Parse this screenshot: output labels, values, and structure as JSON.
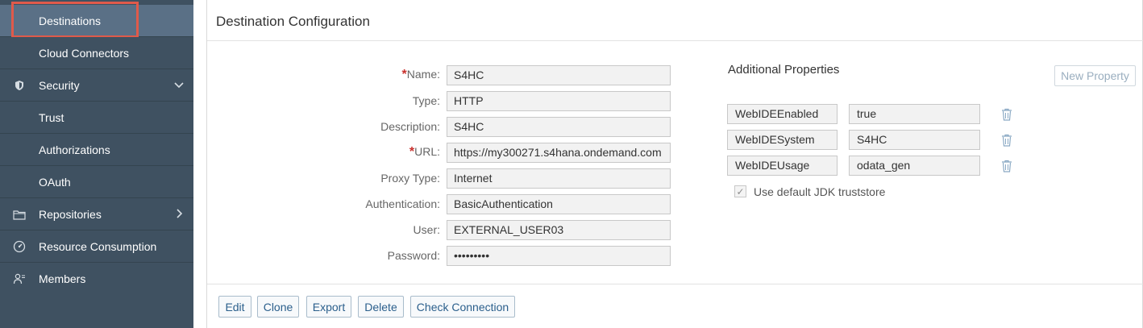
{
  "sidebar": {
    "items": [
      {
        "label": "Destinations",
        "icon": "",
        "active": true
      },
      {
        "label": "Cloud Connectors",
        "icon": ""
      },
      {
        "label": "Security",
        "icon": "shield-icon",
        "chevron": "chevron-down-icon"
      },
      {
        "label": "Trust",
        "icon": ""
      },
      {
        "label": "Authorizations",
        "icon": ""
      },
      {
        "label": "OAuth",
        "icon": ""
      },
      {
        "label": "Repositories",
        "icon": "folder-icon",
        "chevron": "chevron-right-icon"
      },
      {
        "label": "Resource Consumption",
        "icon": "gauge-icon"
      },
      {
        "label": "Members",
        "icon": "members-icon"
      }
    ]
  },
  "main": {
    "title": "Destination Configuration",
    "fields": [
      {
        "label": "Name:",
        "value": "S4HC",
        "required": true
      },
      {
        "label": "Type:",
        "value": "HTTP",
        "required": false
      },
      {
        "label": "Description:",
        "value": "S4HC",
        "required": false
      },
      {
        "label": "URL:",
        "value": "https://my300271.s4hana.ondemand.com",
        "required": true
      },
      {
        "label": "Proxy Type:",
        "value": "Internet",
        "required": false
      },
      {
        "label": "Authentication:",
        "value": "BasicAuthentication",
        "required": false
      },
      {
        "label": "User:",
        "value": "EXTERNAL_USER03",
        "required": false
      },
      {
        "label": "Password:",
        "value": "•••••••••",
        "required": false
      }
    ],
    "required_marker": "*",
    "additional": {
      "title": "Additional Properties",
      "new_property_label": "New Property",
      "properties": [
        {
          "key": "WebIDEEnabled",
          "value": "true"
        },
        {
          "key": "WebIDESystem",
          "value": "S4HC"
        },
        {
          "key": "WebIDEUsage",
          "value": "odata_gen"
        }
      ],
      "checkbox_label": "Use default JDK truststore",
      "checkbox_checked": true
    },
    "buttons": {
      "edit": "Edit",
      "clone": "Clone",
      "export": "Export",
      "delete": "Delete",
      "check": "Check Connection"
    }
  },
  "colors": {
    "sidebar_bg": "#3f5161",
    "active_bg": "#5a7086",
    "highlight": "#e05a4a",
    "required": "#c9302c",
    "button_text": "#2b5f8c"
  }
}
